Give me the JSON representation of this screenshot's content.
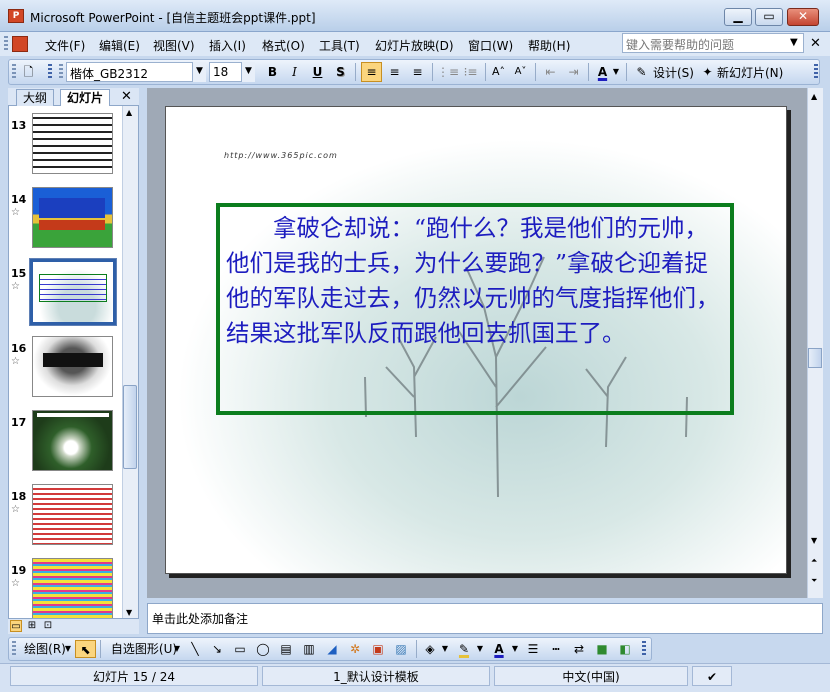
{
  "window": {
    "title": "Microsoft PowerPoint - [自信主题班会ppt课件.ppt]",
    "app_icon": "P",
    "controls": {
      "minimize": "▁",
      "maximize": "▭",
      "close": "✕"
    }
  },
  "menu": {
    "items": [
      "文件(F)",
      "编辑(E)",
      "视图(V)",
      "插入(I)",
      "格式(O)",
      "工具(T)",
      "幻灯片放映(D)",
      "窗口(W)",
      "帮助(H)"
    ],
    "help_placeholder": "键入需要帮助的问题",
    "close_glyph": "✕"
  },
  "format_toolbar": {
    "font_name": "楷体_GB2312",
    "font_size": "18",
    "bold": "B",
    "italic": "I",
    "underline": "U",
    "shadow": "S",
    "font_grow": "A˄",
    "font_shrink": "A˅",
    "font_color": "A",
    "design_label": "设计(S)",
    "new_slide_label": "新幻灯片(N)"
  },
  "left_panel": {
    "tabs": {
      "outline": "大纲",
      "slides": "幻灯片"
    },
    "close_glyph": "✕",
    "slides": [
      {
        "number": "13",
        "star": ""
      },
      {
        "number": "14",
        "star": "☆"
      },
      {
        "number": "15",
        "star": "☆",
        "selected": true
      },
      {
        "number": "16",
        "star": "☆"
      },
      {
        "number": "17",
        "star": ""
      },
      {
        "number": "18",
        "star": "☆"
      },
      {
        "number": "19",
        "star": "☆"
      }
    ]
  },
  "slide": {
    "url_text": "http://www.365pic.com",
    "body_text": "拿破仑却说：“跑什么？我是他们的元帅，他们是我的士兵，为什么要跑？”拿破仑迎着捉他的军队走过去，仍然以元帅的气度指挥他们，结果这批军队反而跟他回去抓国王了。"
  },
  "notes": {
    "placeholder": "单击此处添加备注"
  },
  "draw_toolbar": {
    "draw_label": "绘图(R)",
    "autoshapes_label": "自选图形(U)"
  },
  "status": {
    "slide_position": "幻灯片 15 / 24",
    "design_template": "1_默认设计模板",
    "language": "中文(中国)"
  },
  "colors": {
    "textbox_border": "#0b7d1d",
    "body_text": "#1d1dbf",
    "selection_border": "#2e5fa8"
  }
}
